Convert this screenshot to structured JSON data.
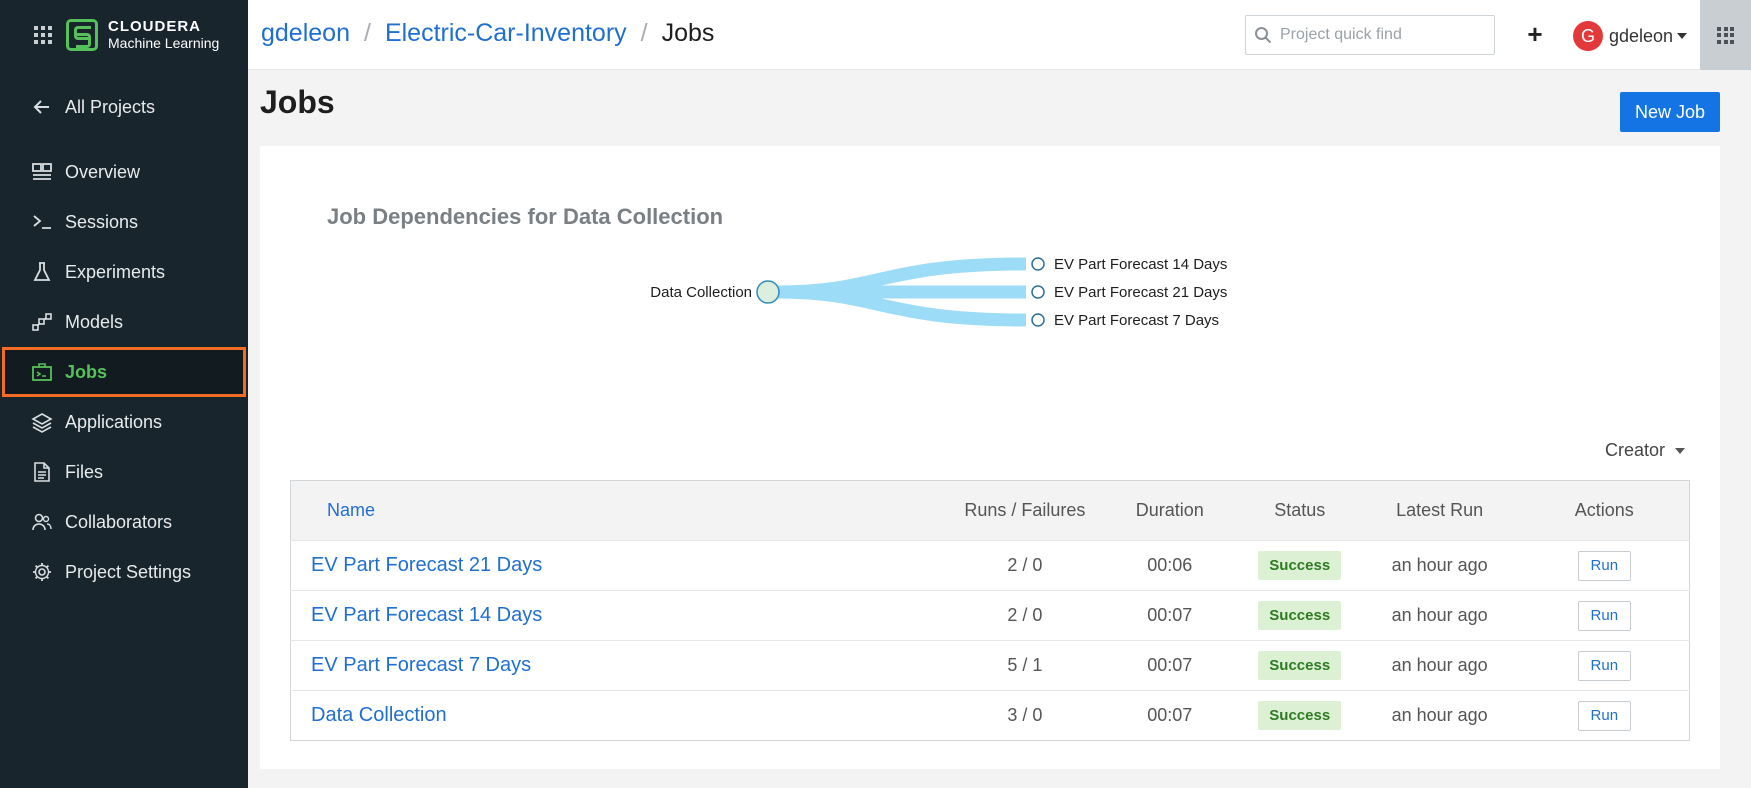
{
  "brand": {
    "name_line1": "CLOUDERA",
    "name_line2": "Machine Learning"
  },
  "sidebar": {
    "back": {
      "label": "All Projects",
      "icon": "arrow-left-icon"
    },
    "items": [
      {
        "label": "Overview",
        "icon": "overview-icon",
        "active": false
      },
      {
        "label": "Sessions",
        "icon": "terminal-icon",
        "active": false
      },
      {
        "label": "Experiments",
        "icon": "flask-icon",
        "active": false
      },
      {
        "label": "Models",
        "icon": "models-icon",
        "active": false
      },
      {
        "label": "Jobs",
        "icon": "jobs-icon",
        "active": true
      },
      {
        "label": "Applications",
        "icon": "layers-icon",
        "active": false
      },
      {
        "label": "Files",
        "icon": "file-icon",
        "active": false
      },
      {
        "label": "Collaborators",
        "icon": "users-icon",
        "active": false
      },
      {
        "label": "Project Settings",
        "icon": "gear-icon",
        "active": false
      }
    ]
  },
  "header": {
    "breadcrumb": [
      "gdeleon",
      "Electric-Car-Inventory",
      "Jobs"
    ],
    "search_placeholder": "Project quick find",
    "plus_label": "+",
    "user_name": "gdeleon",
    "user_initial": "G"
  },
  "page": {
    "title": "Jobs",
    "new_job_label": "New Job"
  },
  "dependencies": {
    "title": "Job Dependencies for Data Collection",
    "root": "Data Collection",
    "children": [
      "EV Part Forecast 14 Days",
      "EV Part Forecast 21 Days",
      "EV Part Forecast 7 Days"
    ]
  },
  "filter": {
    "creator_label": "Creator"
  },
  "table": {
    "headers": {
      "name": "Name",
      "runs": "Runs / Failures",
      "duration": "Duration",
      "status": "Status",
      "latest": "Latest Run",
      "actions": "Actions"
    },
    "rows": [
      {
        "name": "EV Part Forecast 21 Days",
        "runs": "2 / 0",
        "duration": "00:06",
        "status": "Success",
        "latest": "an hour ago",
        "action": "Run"
      },
      {
        "name": "EV Part Forecast 14 Days",
        "runs": "2 / 0",
        "duration": "00:07",
        "status": "Success",
        "latest": "an hour ago",
        "action": "Run"
      },
      {
        "name": "EV Part Forecast 7 Days",
        "runs": "5 / 1",
        "duration": "00:07",
        "status": "Success",
        "latest": "an hour ago",
        "action": "Run"
      },
      {
        "name": "Data Collection",
        "runs": "3 / 0",
        "duration": "00:07",
        "status": "Success",
        "latest": "an hour ago",
        "action": "Run"
      }
    ]
  },
  "colors": {
    "sidebar_bg": "#18252c",
    "accent_green": "#56c05a",
    "active_outline": "#f36c21",
    "link_blue": "#1f6fd1",
    "primary_button": "#1474e4",
    "success_bg": "#dcf1d4",
    "success_text": "#2f7a23",
    "graph_edge": "#9ddcf7"
  }
}
